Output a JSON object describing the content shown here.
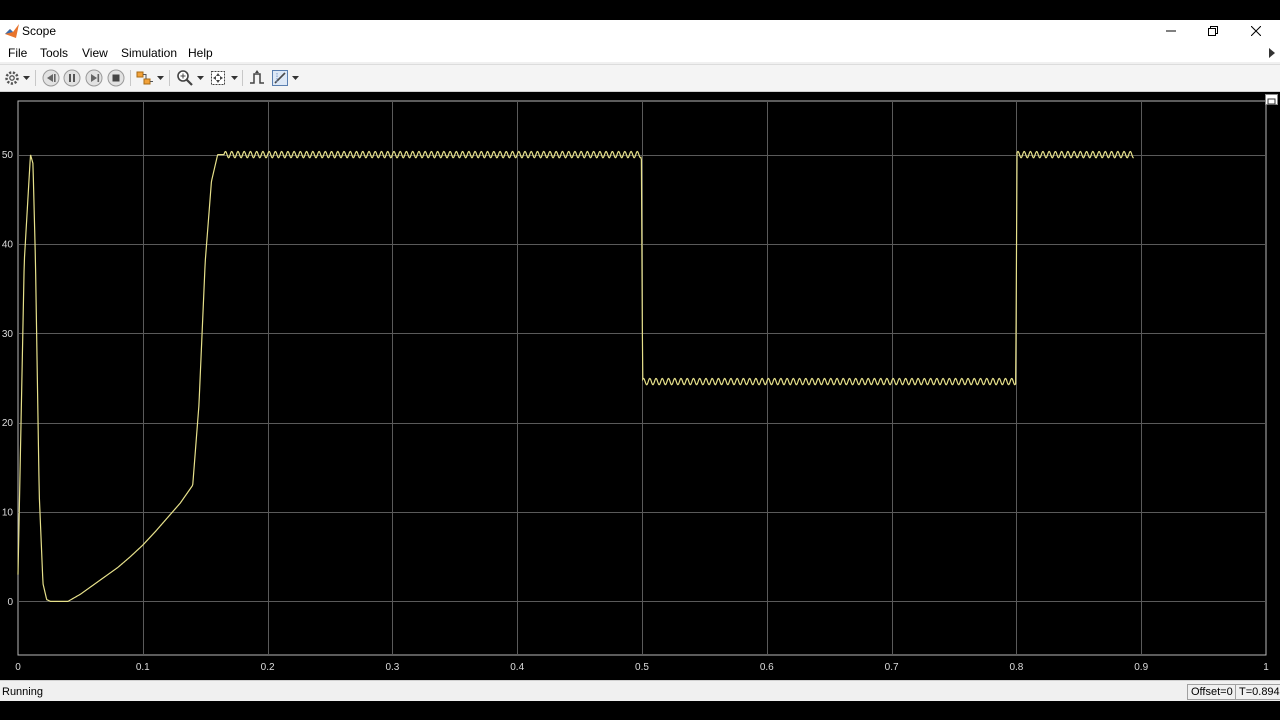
{
  "window": {
    "title": "Scope"
  },
  "menu": {
    "items": [
      "File",
      "Tools",
      "View",
      "Simulation",
      "Help"
    ]
  },
  "status": {
    "text": "Running",
    "offset": "Offset=0",
    "time": "T=0.894"
  },
  "colors": {
    "trace": "#e6e08a",
    "grid": "#5a5a5a",
    "axes_bg": "#000000",
    "tick_label": "#dcdcdc"
  },
  "chart_data": {
    "type": "line",
    "xlim": [
      0,
      1
    ],
    "ylim": [
      -6,
      56
    ],
    "xticks": [
      0,
      0.1,
      0.2,
      0.3,
      0.4,
      0.5,
      0.6,
      0.7,
      0.8,
      0.9,
      1
    ],
    "xtick_labels": [
      "0",
      "0.1",
      "0.2",
      "0.3",
      "0.4",
      "0.5",
      "0.6",
      "0.7",
      "0.8",
      "0.9",
      "1"
    ],
    "yticks": [
      0,
      10,
      20,
      30,
      40,
      50
    ],
    "ytick_labels": [
      "0",
      "10",
      "20",
      "30",
      "40",
      "50"
    ],
    "grid": true,
    "series": [
      {
        "x": [
          0,
          0.005,
          0.01,
          0.012,
          0.014,
          0.017,
          0.02,
          0.023,
          0.026,
          0.03,
          0.04,
          0.05,
          0.06,
          0.07,
          0.08,
          0.09,
          0.1,
          0.11,
          0.12,
          0.13,
          0.14,
          0.145,
          0.15,
          0.155,
          0.16,
          0.165,
          0.2,
          0.25,
          0.3,
          0.35,
          0.4,
          0.45,
          0.4995,
          0.5005,
          0.55,
          0.6,
          0.65,
          0.7,
          0.75,
          0.7995,
          0.8005,
          0.85,
          0.894
        ],
        "y": [
          3,
          38,
          50,
          49,
          38,
          12,
          2,
          0.2,
          0,
          0,
          0,
          0.8,
          1.8,
          2.8,
          3.8,
          5,
          6.3,
          7.8,
          9.4,
          11,
          13,
          22,
          38,
          47,
          50,
          50,
          50,
          50,
          50,
          50,
          50,
          50,
          50,
          24.6,
          24.6,
          24.6,
          24.6,
          24.6,
          24.6,
          24.6,
          50,
          50,
          50
        ]
      }
    ]
  }
}
